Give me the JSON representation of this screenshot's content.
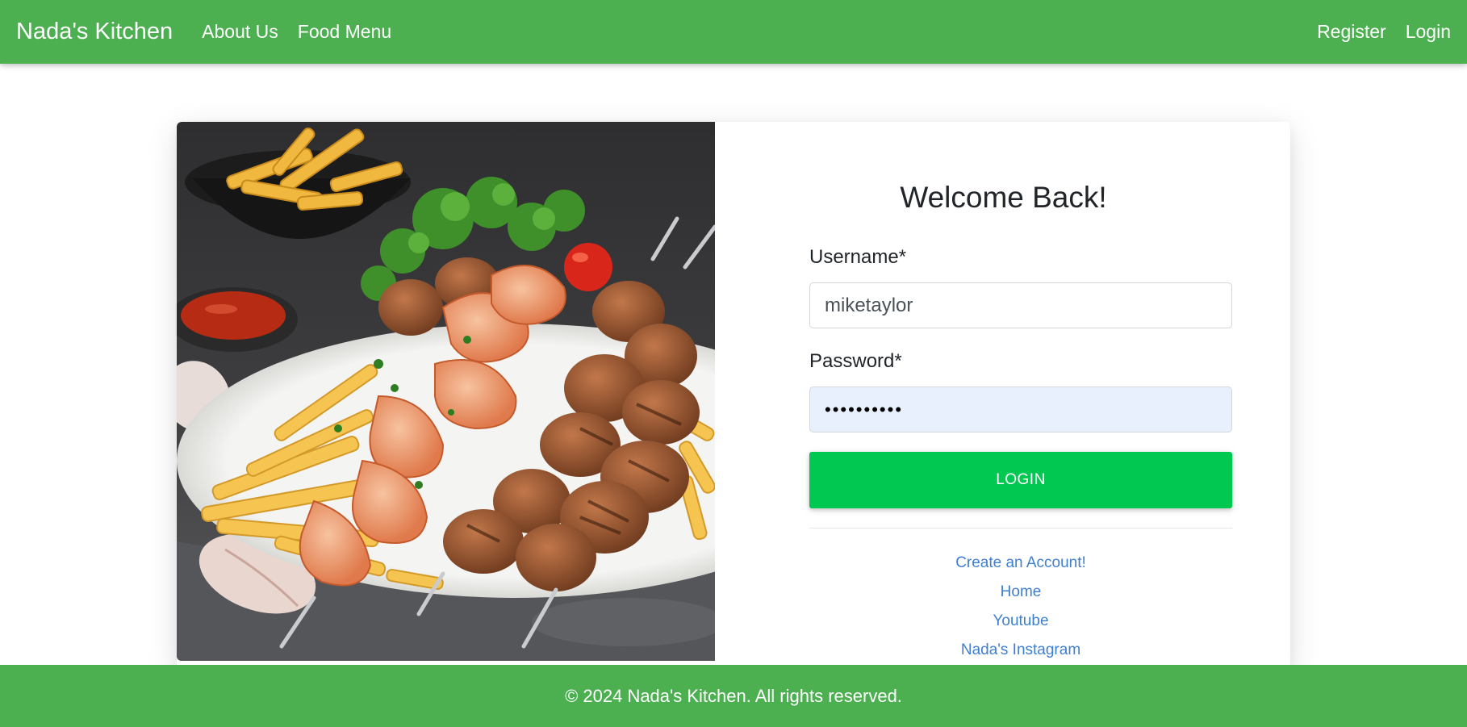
{
  "navbar": {
    "brand": "Nada's Kitchen",
    "left_links": [
      "About Us",
      "Food Menu"
    ],
    "right_links": [
      "Register",
      "Login"
    ],
    "background_color": "#4caf50"
  },
  "login_card": {
    "image_alt": "Grilled shrimp and chicken skewers with fries, tomato, parsley, ketchup and garlic",
    "title": "Welcome Back!",
    "username_label": "Username*",
    "username_value": "miketaylor",
    "password_label": "Password*",
    "password_masked": "••••••••••",
    "login_button": "LOGIN",
    "login_button_color": "#00c851",
    "links": [
      "Create an Account!",
      "Home",
      "Youtube",
      "Nada's Instagram"
    ],
    "link_color": "#3f7fd0"
  },
  "footer": {
    "text": "© 2024 Nada's Kitchen. All rights reserved."
  }
}
